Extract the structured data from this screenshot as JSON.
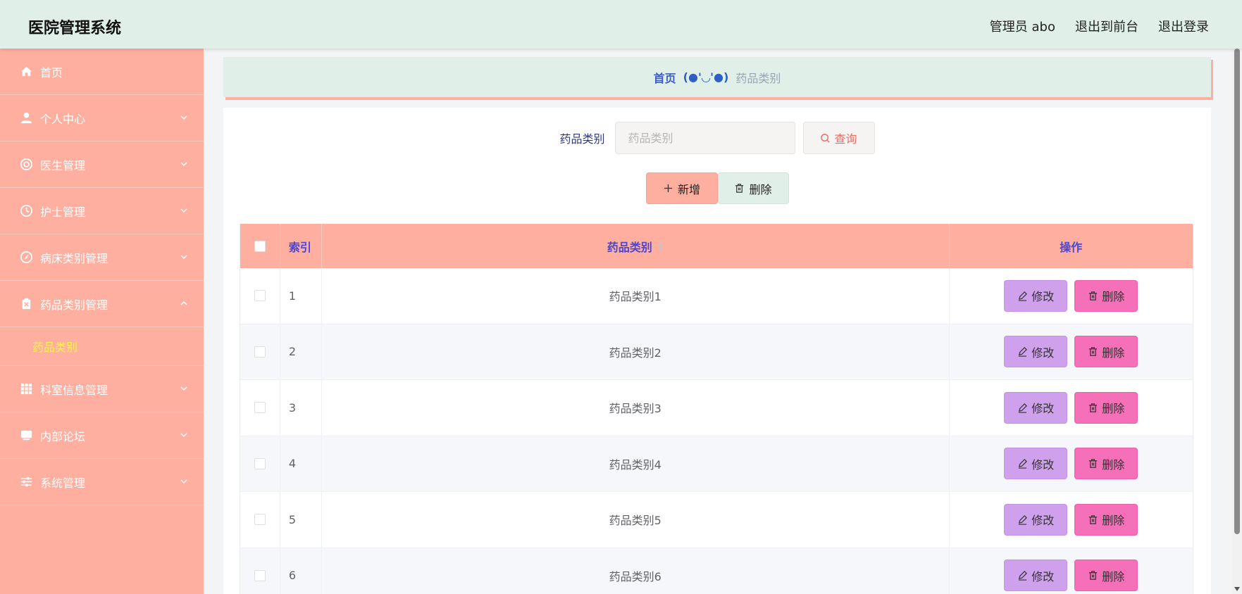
{
  "app": {
    "title": "医院管理系统"
  },
  "header": {
    "user": "管理员 abo",
    "front": "退出到前台",
    "logout": "退出登录"
  },
  "sidebar": {
    "items": [
      {
        "label": "首页",
        "icon": "home-icon"
      },
      {
        "label": "个人中心",
        "icon": "user-icon"
      },
      {
        "label": "医生管理",
        "icon": "lifebuoy-icon"
      },
      {
        "label": "护士管理",
        "icon": "clock-icon"
      },
      {
        "label": "病床类别管理",
        "icon": "compass-icon"
      },
      {
        "label": "药品类别管理",
        "icon": "medicine-box-icon"
      },
      {
        "label": "科室信息管理",
        "icon": "grid-icon"
      },
      {
        "label": "内部论坛",
        "icon": "forum-icon"
      },
      {
        "label": "系统管理",
        "icon": "sliders-icon"
      }
    ],
    "submenu": {
      "label": "药品类别"
    }
  },
  "breadcrumb": {
    "home": "首页",
    "separator": "(●'◡'●)",
    "current": "药品类别"
  },
  "search": {
    "label": "药品类别",
    "placeholder": "药品类别",
    "button": "查询"
  },
  "actions": {
    "add": "新增",
    "delete": "删除"
  },
  "table": {
    "columns": {
      "index": "索引",
      "category": "药品类别",
      "operation": "操作"
    },
    "edit_label": "修改",
    "delete_label": "删除",
    "rows": [
      {
        "index": "1",
        "category": "药品类别1"
      },
      {
        "index": "2",
        "category": "药品类别2"
      },
      {
        "index": "3",
        "category": "药品类别3"
      },
      {
        "index": "4",
        "category": "药品类别4"
      },
      {
        "index": "5",
        "category": "药品类别5"
      },
      {
        "index": "6",
        "category": "药品类别6"
      }
    ]
  },
  "colors": {
    "header_bg": "#e0efe7",
    "sidebar_bg": "#ffaf9f",
    "submenu_active": "#fff93b",
    "edit_button": "#cfa0ec",
    "delete_button": "#f56fb9",
    "column_header_text": "#4b46d6"
  }
}
